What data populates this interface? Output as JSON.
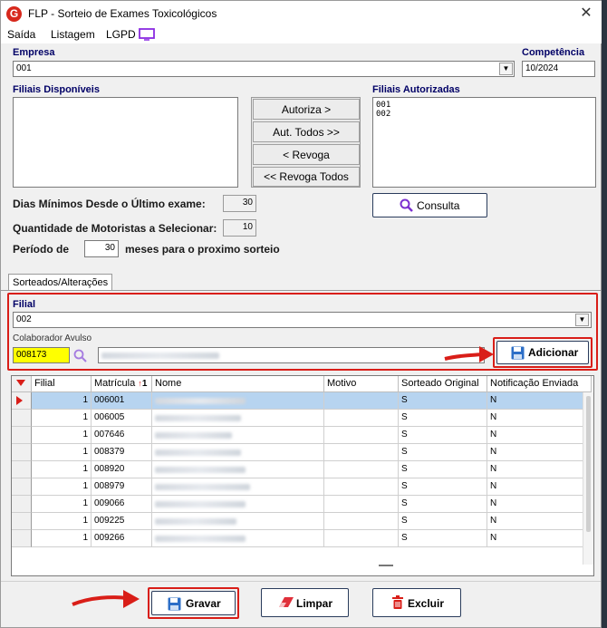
{
  "window": {
    "title": "FLP - Sorteio de Exames Toxicológicos",
    "app_icon": "G"
  },
  "menu": [
    "Saída",
    "Listagem",
    "LGPD"
  ],
  "empresa": {
    "label": "Empresa",
    "value": "001"
  },
  "competencia": {
    "label": "Competência",
    "value": "10/2024"
  },
  "filiais_disponiveis": {
    "label": "Filiais Disponíveis",
    "items": []
  },
  "filiais_autorizadas": {
    "label": "Filiais Autorizadas",
    "items": [
      "001",
      "002"
    ]
  },
  "transfer_buttons": {
    "autoriza": "Autoriza >",
    "aut_todos": "Aut. Todos >>",
    "revoga": "< Revoga",
    "revoga_todos": "<< Revoga Todos"
  },
  "consulta_label": "Consulta",
  "params": {
    "dias_label": "Dias Mínimos Desde o Último exame:",
    "dias_value": "30",
    "qtd_label": "Quantidade de Motoristas a Selecionar:",
    "qtd_value": "10",
    "periodo_label": "Período  de",
    "periodo_value": "30",
    "periodo_suffix": "meses  para o proximo sorteio"
  },
  "tab_label": "Sorteados/Alterações",
  "filial": {
    "label": "Filial",
    "value": "002"
  },
  "colaborador": {
    "label": "Colaborador Avulso",
    "value": "008173"
  },
  "adicionar_label": "Adicionar",
  "grid": {
    "columns": [
      "Filial",
      "Matrícula",
      "Nome",
      "Motivo",
      "Sorteado Original",
      "Notificação Enviada"
    ],
    "sort_indicator": "1",
    "rows": [
      {
        "filial": "1",
        "matricula": "006001",
        "motivo": "",
        "sorteado": "S",
        "notificacao": "N"
      },
      {
        "filial": "1",
        "matricula": "006005",
        "motivo": "",
        "sorteado": "S",
        "notificacao": "N"
      },
      {
        "filial": "1",
        "matricula": "007646",
        "motivo": "",
        "sorteado": "S",
        "notificacao": "N"
      },
      {
        "filial": "1",
        "matricula": "008379",
        "motivo": "",
        "sorteado": "S",
        "notificacao": "N"
      },
      {
        "filial": "1",
        "matricula": "008920",
        "motivo": "",
        "sorteado": "S",
        "notificacao": "N"
      },
      {
        "filial": "1",
        "matricula": "008979",
        "motivo": "",
        "sorteado": "S",
        "notificacao": "N"
      },
      {
        "filial": "1",
        "matricula": "009066",
        "motivo": "",
        "sorteado": "S",
        "notificacao": "N"
      },
      {
        "filial": "1",
        "matricula": "009225",
        "motivo": "",
        "sorteado": "S",
        "notificacao": "N"
      },
      {
        "filial": "1",
        "matricula": "009266",
        "motivo": "",
        "sorteado": "S",
        "notificacao": "N"
      }
    ]
  },
  "bottom": {
    "gravar": "Gravar",
    "limpar": "Limpar",
    "excluir": "Excluir"
  },
  "colors": {
    "label_blue": "#000066",
    "highlight_red": "#d91e18",
    "selected_row": "#b7d4f0",
    "colaborador_bg": "#ffff00"
  }
}
